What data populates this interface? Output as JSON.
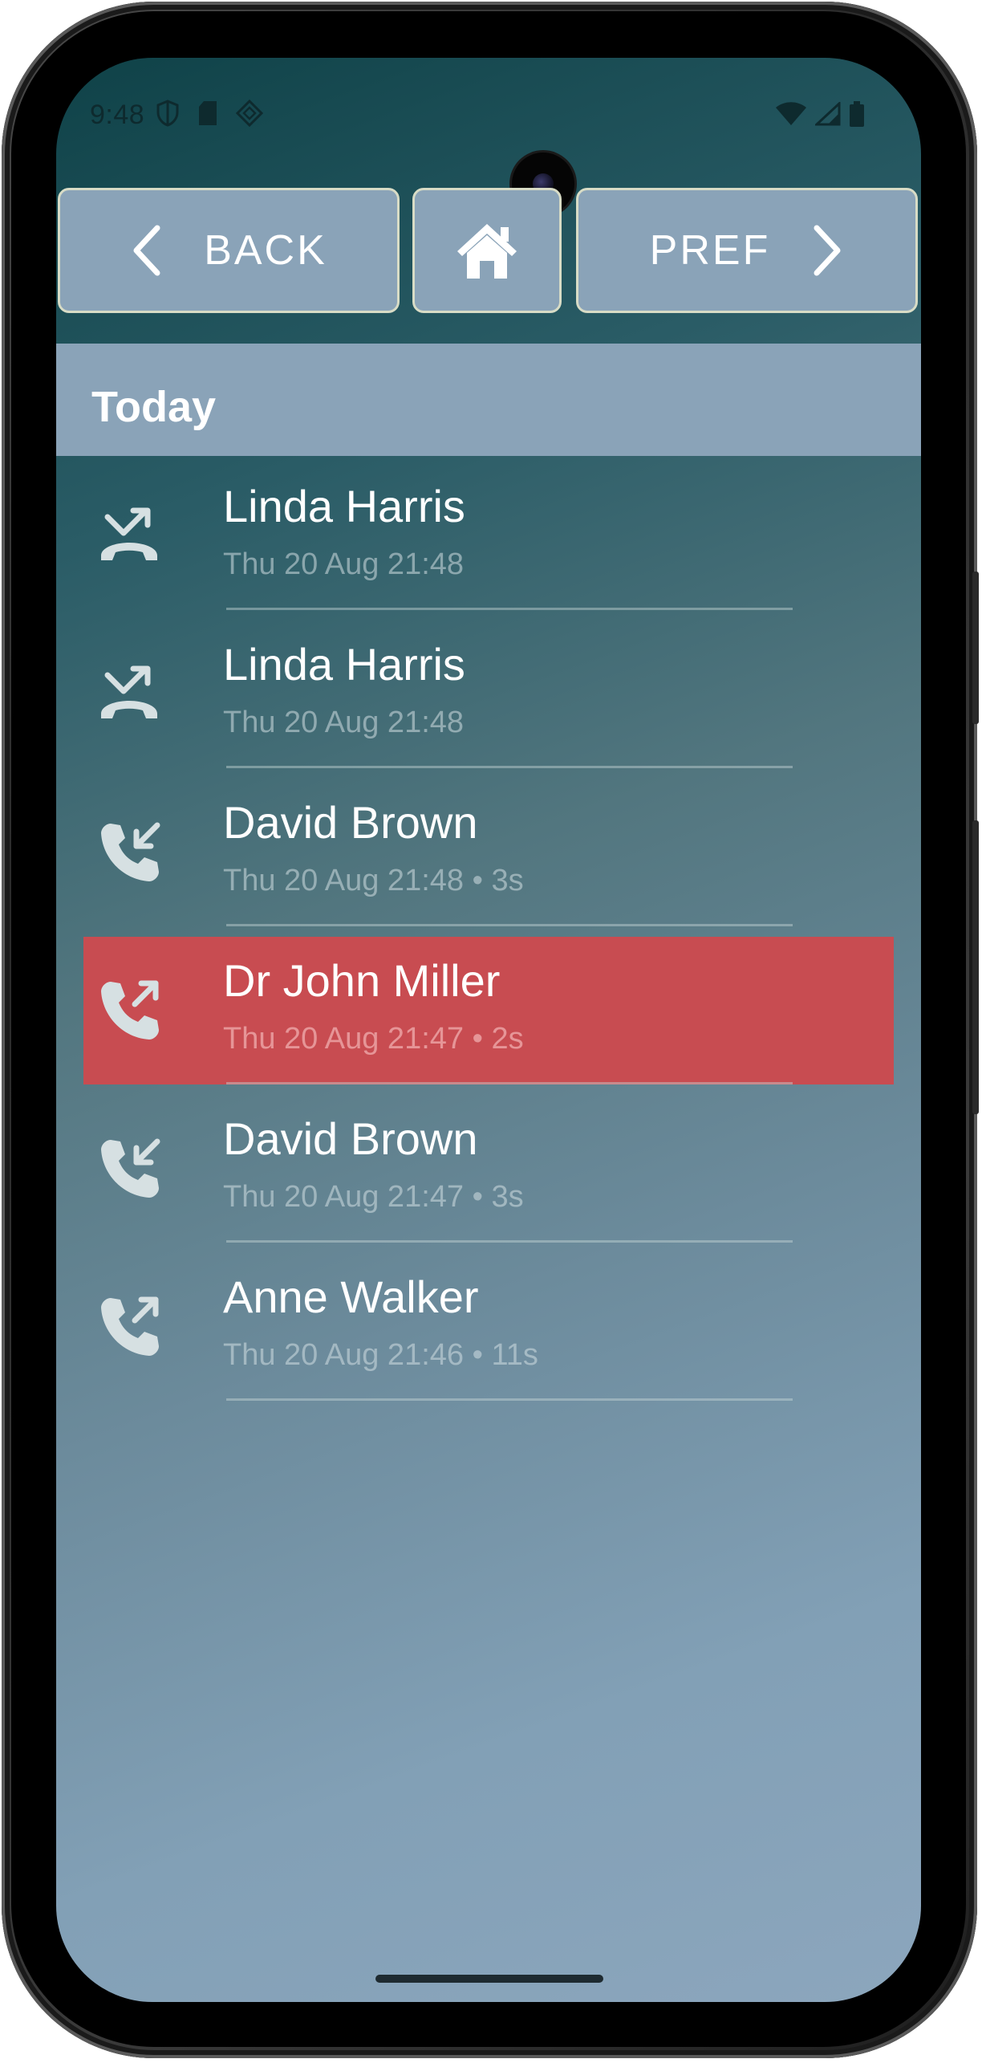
{
  "status_bar": {
    "time": "9:48",
    "left_icons": [
      "shield-icon",
      "sd-card-icon",
      "diamond-icon"
    ],
    "right_icons": [
      "wifi-icon",
      "signal-icon",
      "battery-icon"
    ]
  },
  "nav": {
    "back_label": "BACK",
    "pref_label": "PREF"
  },
  "section": {
    "title": "Today"
  },
  "calls": [
    {
      "name": "Linda Harris",
      "detail": "Thu 20 Aug 21:48",
      "type": "rejected",
      "icon": "rejected-call-icon",
      "selected": false
    },
    {
      "name": "Linda Harris",
      "detail": "Thu 20 Aug 21:48",
      "type": "rejected",
      "icon": "rejected-call-icon",
      "selected": false
    },
    {
      "name": "David Brown",
      "detail": "Thu 20 Aug 21:48 • 3s",
      "type": "incoming",
      "icon": "incoming-call-icon",
      "selected": false
    },
    {
      "name": "Dr John Miller",
      "detail": "Thu 20 Aug 21:47 • 2s",
      "type": "outgoing",
      "icon": "outgoing-call-icon",
      "selected": true
    },
    {
      "name": "David Brown",
      "detail": "Thu 20 Aug 21:47 • 3s",
      "type": "incoming",
      "icon": "incoming-call-icon",
      "selected": false
    },
    {
      "name": "Anne Walker",
      "detail": "Thu 20 Aug 21:46 • 11s",
      "type": "outgoing",
      "icon": "outgoing-call-icon",
      "selected": false
    }
  ],
  "colors": {
    "nav_button": "#8aa3b8",
    "nav_border": "#d8dcc6",
    "selected_row": "#c84c51",
    "icon": "#d6e0e2"
  }
}
